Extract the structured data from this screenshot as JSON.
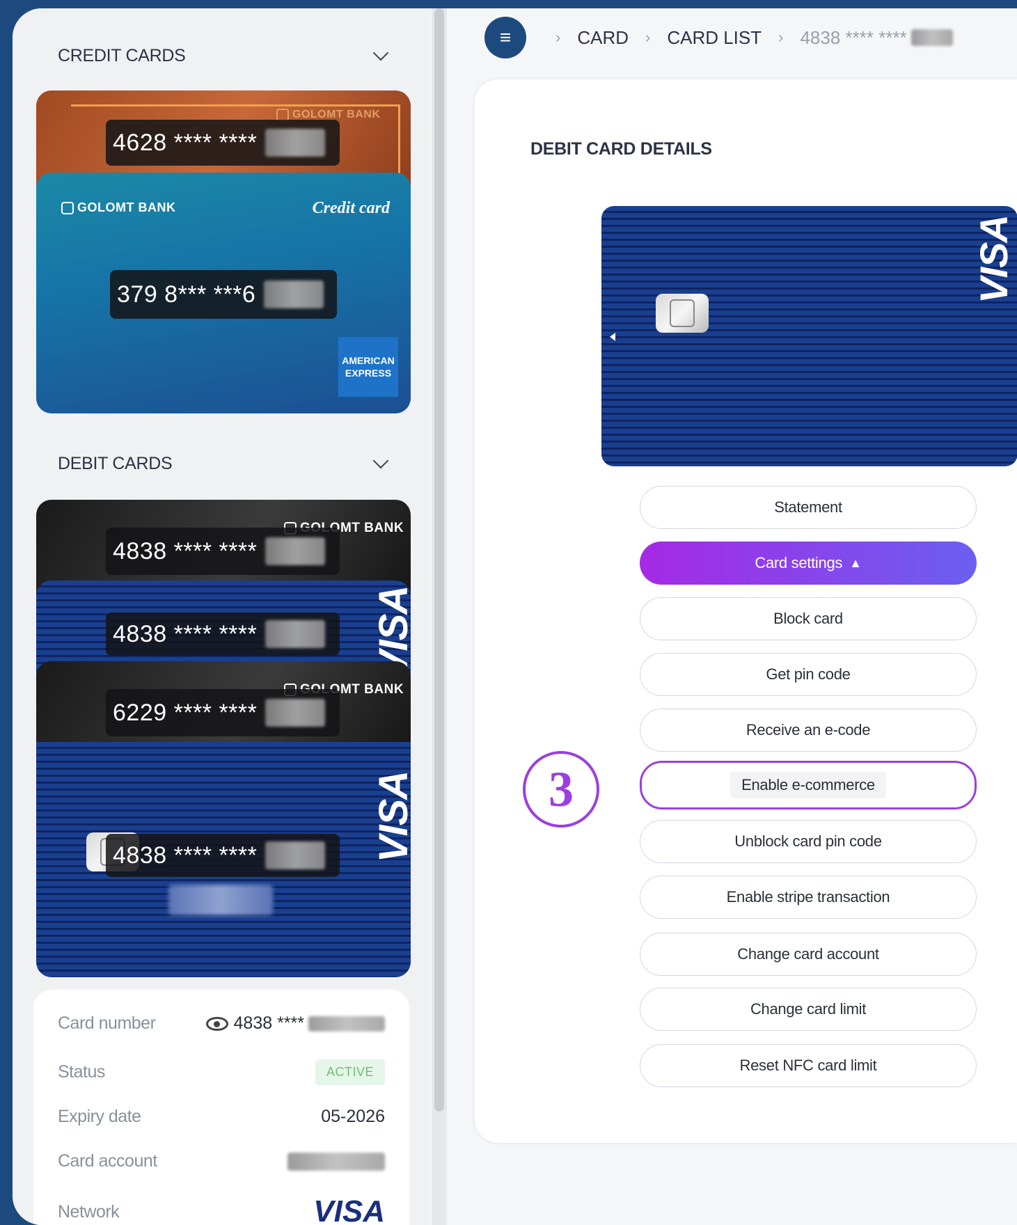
{
  "sidebar": {
    "credit_section": "CREDIT CARDS",
    "debit_section": "DEBIT CARDS",
    "credit_cards": [
      {
        "bank": "GOLOMT BANK",
        "number": "4628 **** ****"
      },
      {
        "bank": "GOLOMT BANK",
        "type_label": "Credit card",
        "number": "379 8*** ***6",
        "network_line1": "AMERICAN",
        "network_line2": "EXPRESS"
      }
    ],
    "debit_cards": [
      {
        "bank": "GOLOMT BANK",
        "number": "4838 **** ****"
      },
      {
        "network": "VISA",
        "number": "4838 **** ****"
      },
      {
        "bank": "GOLOMT BANK",
        "number": "6229 **** ****"
      },
      {
        "network": "VISA",
        "number": "4838 **** ****"
      }
    ],
    "details": {
      "card_number_label": "Card number",
      "card_number_value": "4838 ****",
      "status_label": "Status",
      "status_value": "ACTIVE",
      "expiry_label": "Expiry date",
      "expiry_value": "05-2026",
      "account_label": "Card account",
      "account_value": "",
      "network_label": "Network",
      "network_value": "VISA"
    }
  },
  "breadcrumb": {
    "items": [
      "CARD",
      "CARD LIST",
      "4838 **** ****"
    ]
  },
  "main": {
    "title": "DEBIT CARD DETAILS",
    "card_network": "VISA",
    "actions": [
      "Statement",
      "Card settings",
      "Block card",
      "Get pin code",
      "Receive an e-code",
      "Enable e-commerce",
      "Unblock card pin code",
      "Enable stripe transaction",
      "Change card account",
      "Change card limit",
      "Reset NFC card limit"
    ],
    "step_number": "3"
  },
  "colors": {
    "accent": "#9b3fe0",
    "primary_gradient_start": "#a529e6",
    "primary_gradient_end": "#6b5ff0",
    "background": "#1d4a7e"
  }
}
